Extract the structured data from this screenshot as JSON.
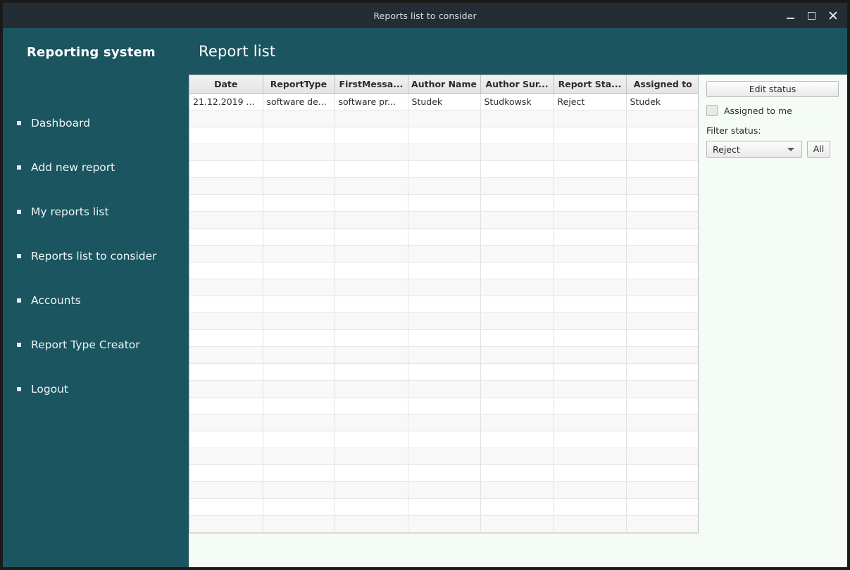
{
  "window": {
    "title": "Reports list to consider",
    "controls": [
      {
        "name": "minimize",
        "label": "–"
      },
      {
        "name": "maximize",
        "label": "□"
      },
      {
        "name": "close",
        "label": "✕"
      }
    ]
  },
  "sidebar": {
    "brand": "Reporting system",
    "items": [
      {
        "label": "Dashboard"
      },
      {
        "label": "Add new report"
      },
      {
        "label": "My reports list"
      },
      {
        "label": "Reports list to consider"
      },
      {
        "label": "Accounts"
      },
      {
        "label": "Report Type Creator"
      },
      {
        "label": "Logout"
      }
    ]
  },
  "main": {
    "page_title": "Report list"
  },
  "table": {
    "columns": [
      "Date",
      "ReportType",
      "FirstMessa...",
      "Author Name",
      "Author Sur...",
      "Report Sta...",
      "Assigned to"
    ],
    "rows": [
      [
        "21.12.2019 ...",
        "software de...",
        "software pr...",
        "Studek",
        "Studkowsk",
        "Reject",
        "Studek"
      ]
    ],
    "empty_row_count": 25
  },
  "panel": {
    "edit_status_label": "Edit status",
    "assigned_to_me_label": "Assigned to me",
    "assigned_to_me_checked": false,
    "filter_status_label": "Filter status:",
    "filter_status_value": "Reject",
    "filter_all_label": "All"
  },
  "colors": {
    "sidebar": "#1a5560",
    "titlebar": "#232d33",
    "content_bg": "#f5fcf5",
    "row_alt": "#f8f8f8"
  }
}
